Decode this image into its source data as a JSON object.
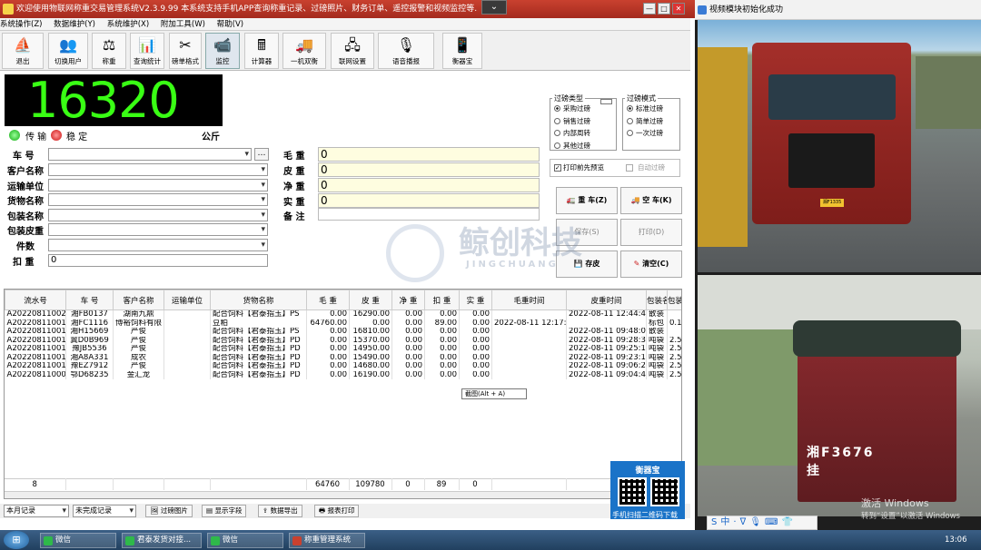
{
  "window": {
    "title": "欢迎使用物联网称重交易管理系统V2.3.9.99 本系统支持手机APP查询称重记录、过磅照片、财务订单、遥控报警和视频监控等.",
    "min": "—",
    "max": "□",
    "close": "✕",
    "drop": "⌄"
  },
  "menu": [
    "系统操作(Z)",
    "数据维护(Y)",
    "系统维护(X)",
    "附加工具(W)",
    "帮助(V)"
  ],
  "toolbar": [
    {
      "label": "退出",
      "icon": "exit-icon",
      "glyph": "⛵"
    },
    {
      "label": "切换用户",
      "icon": "users-icon",
      "glyph": "👥"
    },
    {
      "label": "称重",
      "icon": "scale-icon",
      "glyph": "⚖"
    },
    {
      "label": "查询统计",
      "icon": "chart-icon",
      "glyph": "📊"
    },
    {
      "label": "磅单格式",
      "icon": "tools-icon",
      "glyph": "✂"
    },
    {
      "label": "监控",
      "icon": "camera-icon",
      "glyph": "📹"
    },
    {
      "label": "计算器",
      "icon": "calculator-icon",
      "glyph": "🖩"
    },
    {
      "label": "一机双衡",
      "icon": "truck-icon",
      "glyph": "🚚"
    },
    {
      "label": "联网设置",
      "icon": "network-icon",
      "glyph": "🖧"
    },
    {
      "label": "语音播报",
      "icon": "microphone-icon",
      "glyph": "🎙"
    },
    {
      "label": "衡器宝",
      "icon": "phone-icon",
      "glyph": "📱"
    }
  ],
  "weight": {
    "value": "16320",
    "unit": "公斤",
    "status_transfer": "传 输",
    "status_stable": "稳 定"
  },
  "fields_left": [
    {
      "label": "车  号",
      "value": ""
    },
    {
      "label": "客户名称",
      "value": ""
    },
    {
      "label": "运输单位",
      "value": ""
    },
    {
      "label": "货物名称",
      "value": ""
    },
    {
      "label": "包装名称",
      "value": ""
    },
    {
      "label": "包装皮重",
      "value": ""
    },
    {
      "label": "件数",
      "value": ""
    },
    {
      "label": "扣  重",
      "value": "0"
    }
  ],
  "fields_right": [
    {
      "label": "毛  重",
      "value": "0"
    },
    {
      "label": "皮  重",
      "value": "0"
    },
    {
      "label": "净  重",
      "value": "0"
    },
    {
      "label": "实  重",
      "value": "0"
    },
    {
      "label": "备  注",
      "value": ""
    }
  ],
  "weigh_type": {
    "title": "过磅类型",
    "options": [
      "采购过磅",
      "销售过磅",
      "内部周转",
      "其他过磅"
    ],
    "selected": 0
  },
  "weigh_mode": {
    "title": "过磅模式",
    "options": [
      "标准过磅",
      "简单过磅",
      "一次过磅"
    ],
    "selected": 0
  },
  "print_preview": "打印前先预览",
  "auto_weigh": "自动过磅",
  "actions": {
    "heavy": "重 车(Z)",
    "empty": "空 车(K)",
    "save": "保存(S)",
    "print": "打印(D)",
    "tare": "存皮",
    "clear": "清空(C)"
  },
  "table": {
    "columns": [
      "流水号",
      "车  号",
      "客户名称",
      "运输单位",
      "货物名称",
      "毛  重",
      "皮  重",
      "净  重",
      "扣  重",
      "实  重",
      "毛重时间",
      "皮重时间",
      "包装名称",
      "包装皮重"
    ],
    "rows": [
      [
        "A202208110020",
        "湘FB0137",
        "湖南九鼎",
        "",
        "配合饲料【君泰指玉】PS",
        "0.00",
        "16290.00",
        "0.00",
        "0.00",
        "0.00",
        "",
        "2022-08-11 12:44:42",
        "散装",
        ""
      ],
      [
        "A202208110019",
        "湘FC1116",
        "博裕饲料有限",
        "",
        "豆粕",
        "64760.00",
        "0.00",
        "0.00",
        "89.00",
        "0.00",
        "2022-08-11 12:17:3",
        "",
        "标包",
        "0.12"
      ],
      [
        "A202208110015",
        "湘H15669",
        "严俊",
        "",
        "配合饲料【君泰指玉】PS",
        "0.00",
        "16810.00",
        "0.00",
        "0.00",
        "0.00",
        "",
        "2022-08-11 09:48:03",
        "散装",
        ""
      ],
      [
        "A202208110013",
        "冀D0B969",
        "严俊",
        "",
        "配合饲料【君泰指玉】PD",
        "0.00",
        "15370.00",
        "0.00",
        "0.00",
        "0.00",
        "",
        "2022-08-11 09:28:35",
        "吨袋",
        "2.5"
      ],
      [
        "A202208110012",
        "豫JB5536",
        "严俊",
        "",
        "配合饲料【君泰指玉】PD",
        "0.00",
        "14950.00",
        "0.00",
        "0.00",
        "0.00",
        "",
        "2022-08-11 09:25:15",
        "吨袋",
        "2.5"
      ],
      [
        "A202208110011",
        "湘A8A331",
        "成农",
        "",
        "配合饲料【君泰指玉】PD",
        "0.00",
        "15490.00",
        "0.00",
        "0.00",
        "0.00",
        "",
        "2022-08-11 09:23:18",
        "吨袋",
        "2.5"
      ],
      [
        "A202208110010",
        "豫EZ7912",
        "严俊",
        "",
        "配合饲料【君泰指玉】PD",
        "0.00",
        "14680.00",
        "0.00",
        "0.00",
        "0.00",
        "",
        "2022-08-11 09:06:28",
        "吨袋",
        "2.5"
      ],
      [
        "A202208110009",
        "鄂D68235",
        "金汇龙",
        "",
        "配合饲料【君泰指玉】PD",
        "0.00",
        "16190.00",
        "0.00",
        "0.00",
        "0.00",
        "",
        "2022-08-11 09:04:43",
        "吨袋",
        "2.5"
      ]
    ],
    "footer": [
      "8",
      "",
      "",
      "",
      "",
      "64760",
      "109780",
      "0",
      "89",
      "0",
      "",
      "",
      "",
      ""
    ]
  },
  "tooltip": "截图(Alt + A)",
  "bottom": {
    "range": "本月记录",
    "filter": "未完成记录",
    "btn_photos": "过磅图片",
    "btn_fields": "显示字段",
    "btn_export": "数据导出",
    "btn_print": "报表打印"
  },
  "qr": {
    "title": "衡器宝",
    "caption": "手机扫描二维码下载"
  },
  "watermark": {
    "main": "鲸创科技",
    "sub": "JINGCHUANG"
  },
  "video": {
    "title": "视频模块初始化成功",
    "plate1": "湘F1335",
    "plate2": "湘F3676 挂"
  },
  "activate": {
    "line1": "激活 Windows",
    "line2": "转到“设置”以激活 Windows"
  },
  "ime": "S中·ᐁ🎙⌨👕◫⚙",
  "taskbar": {
    "start": "⊞",
    "tasks": [
      {
        "label": "微信",
        "color": "#2fb94a"
      },
      {
        "label": "君泰发货对接...",
        "color": "#2fb94a"
      },
      {
        "label": "微信",
        "color": "#2fb94a"
      },
      {
        "label": "称重管理系统",
        "color": "#c9412f"
      }
    ],
    "clock": "13:06"
  }
}
